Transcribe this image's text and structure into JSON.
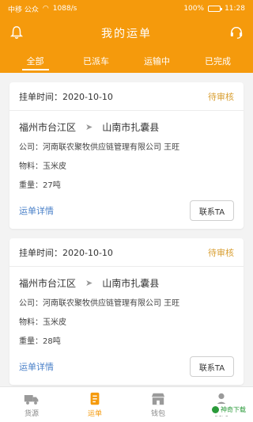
{
  "statusbar": {
    "left": "中移 公众",
    "speed": "1088/s",
    "battery": "100%",
    "time": "11:28"
  },
  "header": {
    "title": "我的运单",
    "left_icon": "bell-icon",
    "right_icon": "headset-icon"
  },
  "tabs": [
    {
      "label": "全部"
    },
    {
      "label": "已派车"
    },
    {
      "label": "运输中"
    },
    {
      "label": "已完成"
    }
  ],
  "orders": [
    {
      "date": "挂单时间：2020-10-10",
      "status": "待审核",
      "from": "福州市台江区",
      "to": "山南市扎囊县",
      "company": "公司：河南联农聚牧供应链管理有限公司 王旺",
      "material": "物料：玉米皮",
      "weight": "重量：27吨",
      "detail": "运单详情",
      "contact": "联系TA"
    },
    {
      "date": "挂单时间：2020-10-10",
      "status": "待审核",
      "from": "福州市台江区",
      "to": "山南市扎囊县",
      "company": "公司：河南联农聚牧供应链管理有限公司 王旺",
      "material": "物料：玉米皮",
      "weight": "重量：28吨",
      "detail": "运单详情",
      "contact": "联系TA"
    }
  ],
  "nav": [
    {
      "label": "货源"
    },
    {
      "label": "运单"
    },
    {
      "label": "钱包"
    },
    {
      "label": "我的"
    }
  ],
  "watermark": "神奇下载",
  "colors": {
    "brand": "#f59a0c",
    "status": "#d9a035",
    "link": "#4a80c8"
  }
}
